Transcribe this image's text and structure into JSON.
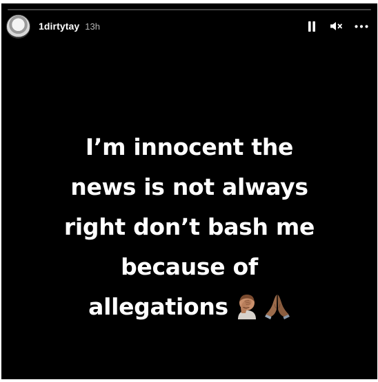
{
  "story": {
    "username": "1dirtytay",
    "time": "13h",
    "progress": 0.0,
    "caption_lines": [
      "I’m innocent the",
      "news is not always",
      "right don’t bash me",
      "because of",
      "allegations"
    ],
    "emojis": [
      "facepalm-emoji",
      "praying-hands-emoji"
    ]
  },
  "controls": {
    "pause_icon": "pause-icon",
    "mute_icon": "muted-speaker-icon",
    "more_icon": "more-options-icon"
  },
  "colors": {
    "background": "#000000",
    "text": "#ffffff",
    "timestamp": "#b6b6b6"
  }
}
